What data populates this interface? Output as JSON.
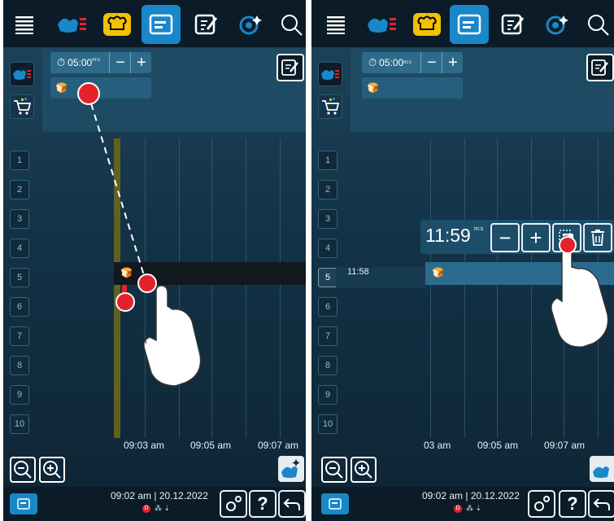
{
  "panels": [
    {
      "timer_label": "05:00",
      "timer_unit": "m:s",
      "minus": "−",
      "plus": "+",
      "slots": [
        "1",
        "2",
        "3",
        "4",
        "5",
        "6",
        "7",
        "8",
        "9",
        "10"
      ],
      "ticks": [
        "09:03 am",
        "09:05 am",
        "09:07 am"
      ],
      "status_time": "09:02 am | 20.12.2022"
    },
    {
      "timer_label": "05:00",
      "timer_unit": "m:s",
      "minus": "−",
      "plus": "+",
      "slots": [
        "1",
        "2",
        "3",
        "4",
        "5",
        "6",
        "7",
        "8",
        "9",
        "10"
      ],
      "ticks": [
        "03 am",
        "09:05 am",
        "09:07 am"
      ],
      "row_time": "11:58",
      "popup_time": "11:59",
      "popup_unit": "m:s",
      "status_time": "09:02 am | 20.12.2022"
    }
  ],
  "icons": {
    "menu": "menu-icon",
    "cook": "cooking-pathways-icon",
    "tray": "chef-hat-icon",
    "planner": "planner-icon",
    "edit": "edit-icon",
    "clean": "cleaning-icon",
    "search": "search-icon"
  },
  "colors": {
    "accent": "#1a87c9",
    "red": "#e3232c",
    "yellow": "#f2c200"
  }
}
